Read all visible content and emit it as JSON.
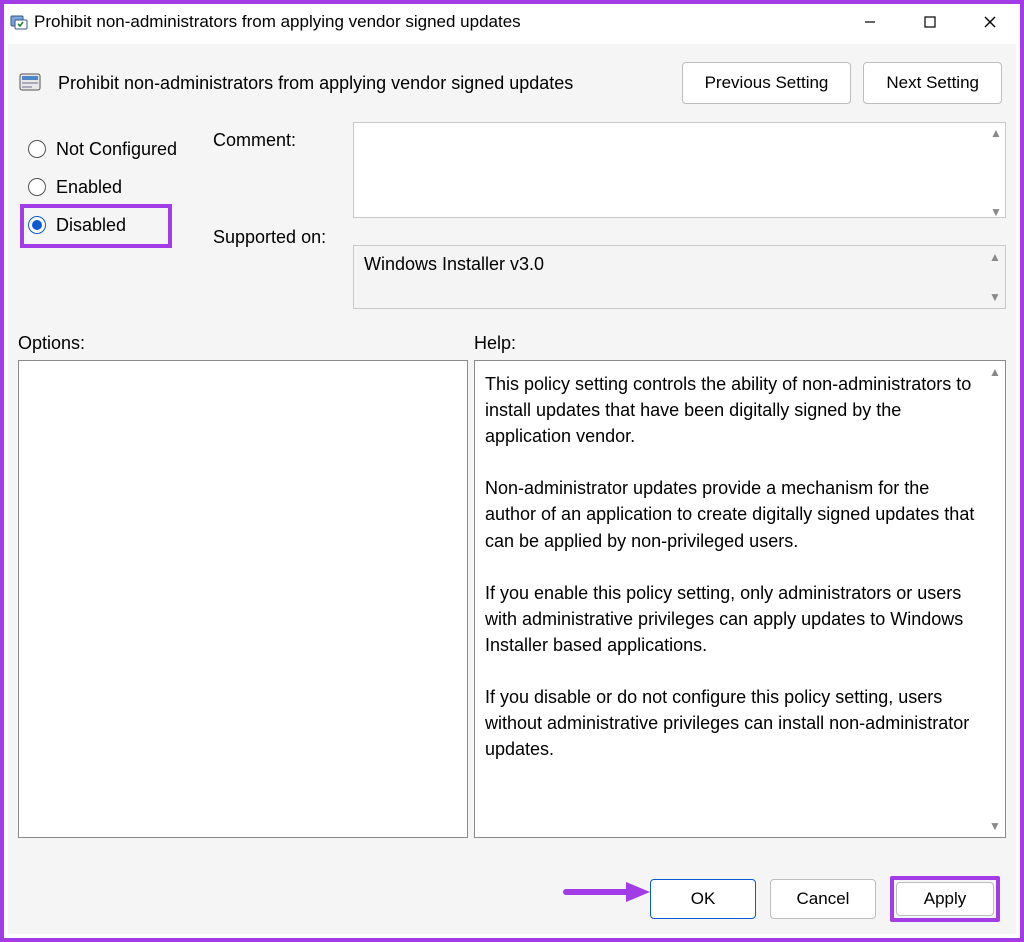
{
  "titlebar": {
    "title": "Prohibit non-administrators from applying vendor signed updates"
  },
  "header": {
    "title": "Prohibit non-administrators from applying vendor signed updates",
    "prev_btn": "Previous Setting",
    "next_btn": "Next Setting"
  },
  "radios": {
    "not_configured": "Not Configured",
    "enabled": "Enabled",
    "disabled": "Disabled",
    "selected": "disabled"
  },
  "labels": {
    "comment": "Comment:",
    "supported": "Supported on:",
    "options": "Options:",
    "help": "Help:"
  },
  "fields": {
    "comment_value": "",
    "supported_value": "Windows Installer v3.0"
  },
  "help_text": "This policy setting controls the ability of non-administrators to install updates that have been digitally signed by the application vendor.\n\nNon-administrator updates provide a mechanism for the author of an application to create digitally signed updates that can be applied by non-privileged users.\n\nIf you enable this policy setting, only administrators or users with administrative privileges can apply updates to Windows Installer based applications.\n\nIf you disable or do not configure this policy setting, users without administrative privileges can install non-administrator updates.",
  "footer": {
    "ok": "OK",
    "cancel": "Cancel",
    "apply": "Apply"
  },
  "colors": {
    "accent": "#A23CE6",
    "primary": "#0a5bd3"
  }
}
